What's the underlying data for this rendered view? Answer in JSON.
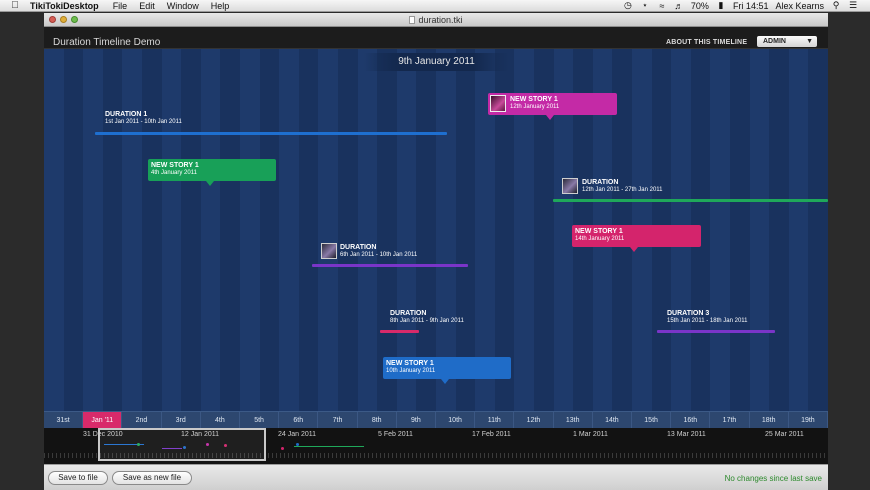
{
  "menubar": {
    "app_name": "TikiTokiDesktop",
    "menus": [
      "File",
      "Edit",
      "Window",
      "Help"
    ],
    "battery": "70%",
    "clock": "Fri 14:51",
    "user": "Alex Kearns"
  },
  "window": {
    "title": "duration.tki"
  },
  "header": {
    "timeline_title": "Duration Timeline Demo",
    "about_link": "ABOUT THIS TIMELINE",
    "admin_label": "ADMIN"
  },
  "current_date": "9th January 2011",
  "durations": [
    {
      "title": "DURATION 1",
      "dates": "1st Jan 2011 - 10th Jan 2011",
      "color": "#1e6fd0"
    },
    {
      "title": "DURATION",
      "dates": "12th Jan 2011 - 27th Jan 2011",
      "color": "#1fa85a"
    },
    {
      "title": "DURATION",
      "dates": "6th Jan 2011 - 10th Jan 2011",
      "color": "#7a35c8"
    },
    {
      "title": "DURATION",
      "dates": "8th Jan 2011 - 9th Jan 2011",
      "color": "#d82a6a"
    },
    {
      "title": "DURATION 3",
      "dates": "15th Jan 2011 - 18th Jan 2011",
      "color": "#7a35c8"
    }
  ],
  "stories": [
    {
      "title": "NEW STORY 1",
      "date": "12th January 2011",
      "color": "#c42aa6"
    },
    {
      "title": "NEW STORY 1",
      "date": "4th January 2011",
      "color": "#18a058"
    },
    {
      "title": "NEW STORY 1",
      "date": "14th January 2011",
      "color": "#d4246c"
    },
    {
      "title": "NEW STORY 1",
      "date": "10th January 2011",
      "color": "#1f6cc8"
    }
  ],
  "day_scale": {
    "days": [
      "31st",
      "Jan '11",
      "2nd",
      "3rd",
      "4th",
      "5th",
      "6th",
      "7th",
      "8th",
      "9th",
      "10th",
      "11th",
      "12th",
      "13th",
      "14th",
      "15th",
      "16th",
      "17th",
      "18th",
      "19th"
    ],
    "selected_index": 1
  },
  "overview": {
    "labels": [
      "31 Dec 2010",
      "12 Jan 2011",
      "24 Jan 2011",
      "5 Feb 2011",
      "17 Feb 2011",
      "1 Mar 2011",
      "13 Mar 2011",
      "25 Mar 2011"
    ]
  },
  "footer": {
    "save_label": "Save to file",
    "save_as_label": "Save as new file",
    "status": "No changes since last save",
    "status_color": "#2d8a2d"
  }
}
